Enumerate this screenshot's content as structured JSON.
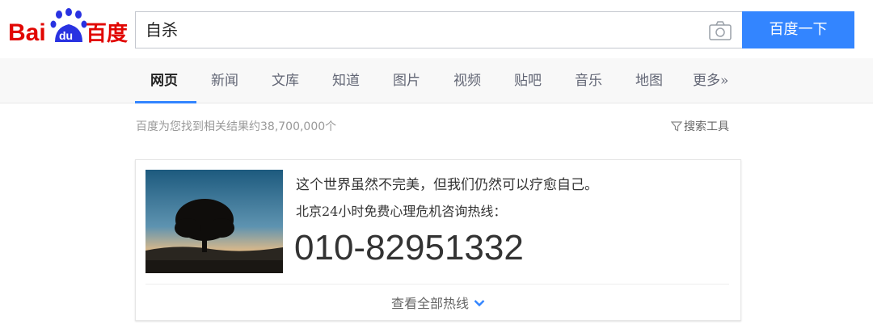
{
  "header": {
    "logo_text": "Bai du 百度",
    "search_value": "自杀",
    "search_button": "百度一下",
    "brand_blue": "#3385ff",
    "brand_red": "#e10602"
  },
  "tabs": [
    {
      "label": "网页",
      "active": true
    },
    {
      "label": "新闻"
    },
    {
      "label": "文库"
    },
    {
      "label": "知道"
    },
    {
      "label": "图片"
    },
    {
      "label": "视频"
    },
    {
      "label": "贴吧"
    },
    {
      "label": "音乐"
    },
    {
      "label": "地图"
    },
    {
      "label": "更多»"
    }
  ],
  "results": {
    "count_text": "百度为您找到相关结果约38,700,000个",
    "tools_label": "搜索工具"
  },
  "card": {
    "line1": "这个世界虽然不完美，但我们仍然可以疗愈自己。",
    "line2": "北京24小时免费心理危机咨询热线：",
    "phone": "010-82951332",
    "view_all": "查看全部热线"
  }
}
